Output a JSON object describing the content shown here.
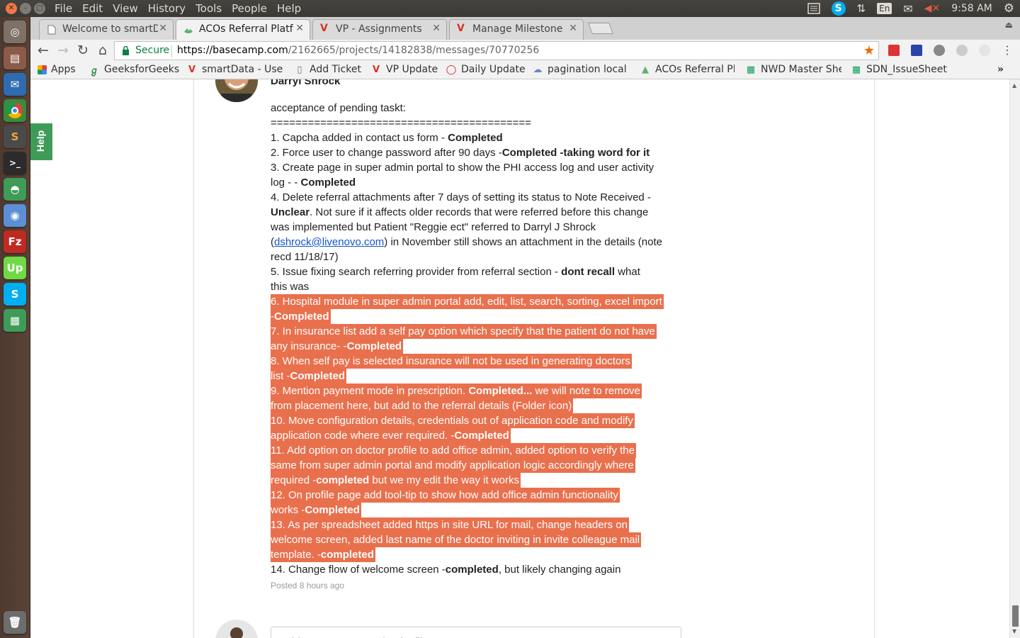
{
  "menubar": {
    "items": [
      "File",
      "Edit",
      "View",
      "History",
      "Tools",
      "People",
      "Help"
    ],
    "tray": {
      "keyboard_layout": "En",
      "time": "9:58 AM"
    }
  },
  "tabs": [
    {
      "title": "Welcome to smartD",
      "icon": "page-icon"
    },
    {
      "title": "ACOs Referral Platf",
      "icon": "basecamp-icon"
    },
    {
      "title": "VP - Assignments",
      "icon": "v-icon"
    },
    {
      "title": "Manage Milestone",
      "icon": "v-icon"
    }
  ],
  "omnibox": {
    "secure_label": "Secure",
    "url_scheme_host": "https://basecamp.com",
    "url_path": "/2162665/projects/14182838/messages/70770256"
  },
  "bookmarks": [
    {
      "label": "Apps",
      "icon": "apps-grid-icon"
    },
    {
      "label": "GeeksforGeeks",
      "icon": "gfg-icon"
    },
    {
      "label": "smartData - User",
      "icon": "v-icon"
    },
    {
      "label": "Add Ticket",
      "icon": "page-icon"
    },
    {
      "label": "VP Update",
      "icon": "v-icon"
    },
    {
      "label": "Daily Update",
      "icon": "opera-icon"
    },
    {
      "label": "pagination local",
      "icon": "cloud-icon"
    },
    {
      "label": "ACOs Referral Pl",
      "icon": "basecamp-icon"
    },
    {
      "label": "NWD Master She",
      "icon": "sheet-icon"
    },
    {
      "label": "SDN_IssueSheet",
      "icon": "sheet-icon"
    }
  ],
  "help_tab": "Help",
  "message": {
    "author": "Darryl Shrock",
    "lines": [
      {
        "text": "acceptance of pending taskt:",
        "hl": false
      },
      {
        "text": "==========================================",
        "hl": false
      },
      {
        "text": "1. Capcha added in contact us form - ",
        "bold": "Completed",
        "hl": false
      },
      {
        "text": "2. Force user to change password after 90 days -",
        "bold": "Completed -taking word for it",
        "hl": false
      },
      {
        "text": "3. Create page in super admin portal to show the PHI access log and user activity",
        "hl": false
      },
      {
        "text": "log  -  - ",
        "bold": "Completed",
        "hl": false
      },
      {
        "text": "4. Delete referral attachments after 7 days of setting its status to Note Received  -",
        "hl": false
      },
      {
        "pre_bold": "Unclear",
        "text": ". Not sure if it affects older records that were referred before this change",
        "hl": false
      },
      {
        "text": "was implemented but Patient \"Reggie ect\" referred to Darryl J Shrock",
        "hl": false
      },
      {
        "text": "(",
        "link": "dshrock@livenovo.com",
        "after": ") in November still shows an attachment in the details (note",
        "hl": false
      },
      {
        "text": "recd 11/18/17)",
        "hl": false
      },
      {
        "text": "5. Issue fixing search referring provider from referral section   - ",
        "bold": "dont recall",
        "after": " what",
        "hl": false
      },
      {
        "text": "this was",
        "hl": false
      },
      {
        "text": "6. Hospital module in super admin portal add, edit, list, search, sorting, excel import",
        "hl": true
      },
      {
        "text": "-",
        "bold": "Completed",
        "hl": true
      },
      {
        "text": "7. In insurance list add a self pay option which specify that the patient do not have",
        "hl": true
      },
      {
        "text": "any insurance-  -",
        "bold": "Completed",
        "hl": true
      },
      {
        "text": " 8. When self pay is selected insurance will not be used in generating doctors",
        "hl": true
      },
      {
        "text": "list   -",
        "bold": "Completed",
        "hl": true
      },
      {
        "text": "9. Mention payment mode in prescription. ",
        "bold": "Completed...",
        "after": " we will note to remove",
        "hl": true
      },
      {
        "text": "from placement here, but add to the referral details (Folder icon)",
        "hl": true
      },
      {
        "text": "10. Move configuration details, credentials out of application code and modify",
        "hl": true
      },
      {
        "text": "application code where ever required.   -",
        "bold": "Completed",
        "hl": true
      },
      {
        "text": "11. Add option on doctor profile to add office admin, added option to verify the",
        "hl": true
      },
      {
        "text": "same from super admin portal and modify application logic accordingly where",
        "hl": true
      },
      {
        "text": "required   -",
        "bold": "completed",
        "after": " but we my edit the way it works",
        "hl": true
      },
      {
        "text": " 12. On profile page add tool-tip to show how add office admin functionality",
        "hl": true
      },
      {
        "text": "works   -",
        "bold": "Completed",
        "hl": true
      },
      {
        "text": "13. As per spreadsheet added https in site URL for mail, change headers on",
        "hl": true
      },
      {
        "text": "welcome screen, added last name of the doctor inviting in invite colleague mail",
        "hl": true
      },
      {
        "text": "template.   -",
        "bold": "completed",
        "hl": true
      },
      {
        "text": "14. Change flow of welcome screen   -",
        "bold": "completed",
        "after": ", but likely changing again",
        "hl": false
      }
    ],
    "posted": "Posted 8 hours ago"
  },
  "comment": {
    "placeholder": "Add a comment or upload a file..."
  },
  "colors": {
    "highlight": "#e9704d",
    "secure_green": "#0b8043",
    "help_green": "#3e9c58"
  }
}
